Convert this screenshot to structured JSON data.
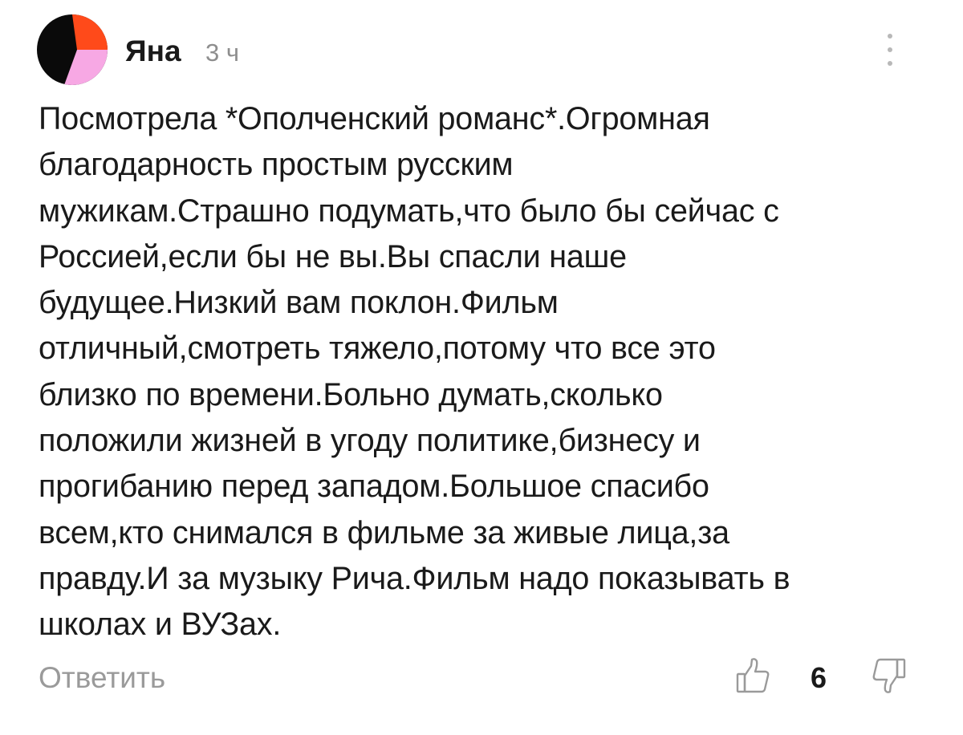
{
  "comment": {
    "author": "Яна",
    "time": "3 ч",
    "text_lines": [
      "Посмотрела *Ополченский романс*.Огромная",
      "благодарность простым русским",
      "мужикам.Страшно подумать,что было бы сейчас с",
      "Россией,если бы не вы.Вы спасли наше",
      "будущее.Низкий вам поклон.Фильм",
      "отличный,смотреть тяжело,потому что все это",
      "близко по времени.Больно думать,сколько",
      "положили жизней в угоду политике,бизнесу и",
      "прогибанию перед западом.Большое спасибо",
      "всем,кто снимался в фильме за живые лица,за",
      "правду.И за музыку Рича.Фильм надо показывать в",
      "школах и ВУЗах."
    ],
    "reply_label": "Ответить",
    "likes": "6"
  },
  "icons": {
    "avatar": "avatar-black-orange-pink",
    "more": "more-vertical-icon",
    "like": "thumbs-up-icon",
    "dislike": "thumbs-down-icon"
  },
  "colors": {
    "avatar_black": "#0a0a0a",
    "avatar_orange": "#ff4a1a",
    "avatar_pink": "#f7a8e4",
    "muted": "#9a9a9a"
  }
}
